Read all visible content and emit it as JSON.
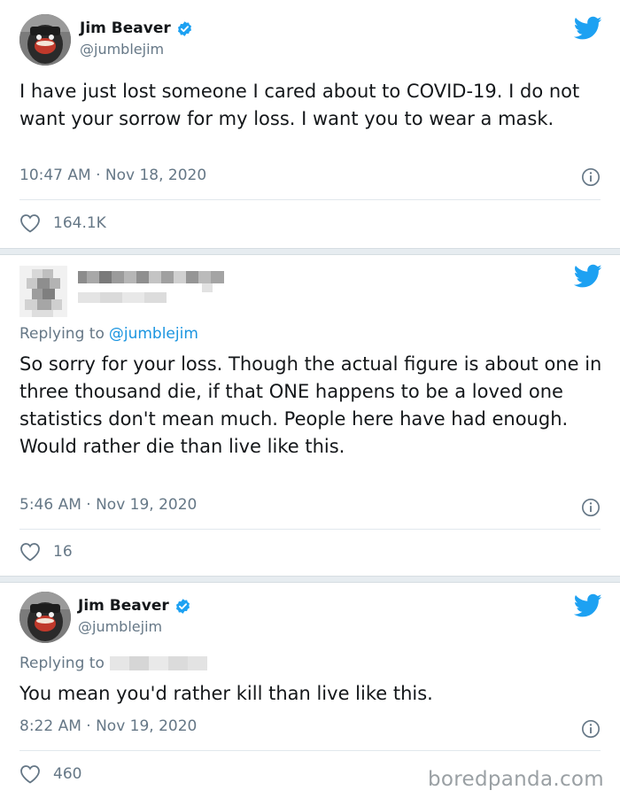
{
  "tweets": [
    {
      "author_name": "Jim Beaver",
      "author_handle": "@jumblejim",
      "text": "I have just lost someone I cared about to COVID-19.  I do not want your sorrow for my loss.  I want you to wear a mask.",
      "timestamp": "10:47 AM · Nov 18, 2020",
      "likes": "164.1K"
    },
    {
      "replying_to_label": "Replying to",
      "replying_to_handle": "@jumblejim",
      "text": "So sorry for your loss. Though the actual figure is about one in three thousand die, if that ONE happens to be a loved one statistics don't mean much. People here have had enough. Would rather die than live like this.",
      "timestamp": "5:46 AM · Nov 19, 2020",
      "likes": "16"
    },
    {
      "author_name": "Jim Beaver",
      "author_handle": "@jumblejim",
      "replying_to_label": "Replying to",
      "text": "You mean you'd rather kill than live like this.",
      "timestamp": "8:22 AM · Nov 19, 2020",
      "likes": "460"
    }
  ],
  "watermark": "boredpanda.com",
  "icons": {
    "verified": "verified-badge-icon",
    "twitter": "twitter-bird-icon",
    "info": "info-icon",
    "like": "heart-icon"
  },
  "colors": {
    "twitter_blue": "#1da1f2",
    "link_blue": "#1b95e0",
    "secondary_text": "#657786",
    "divider": "#e1e8ed"
  }
}
